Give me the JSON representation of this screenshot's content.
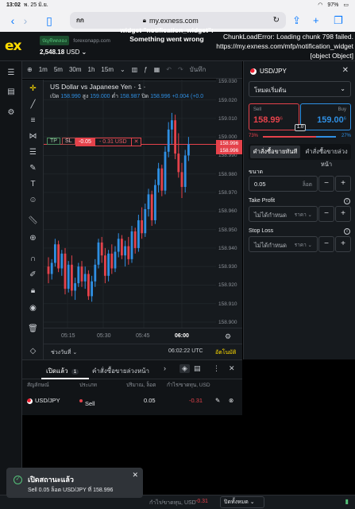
{
  "status_bar": {
    "time": "13:02",
    "date": "พ. 25 มิ.ย.",
    "battery": "97%"
  },
  "safari": {
    "reader_label": "กก",
    "url": "my.exness.com"
  },
  "header": {
    "logo": "ex",
    "account_badge": "บัญชีทดลอง",
    "account_site": "forexonapp.com",
    "balance": "2,548.18",
    "balance_currency": "USD",
    "widget_error": "widget \"notification_widget\": Something went wrong",
    "chunk_error": "ChunkLoadError: Loading chunk 798 failed. https://my.exness.com/mfp/notification_widget [object Object]"
  },
  "chart_header": {
    "timeframes": [
      "1m",
      "5m",
      "30m",
      "1h",
      "15m"
    ],
    "active_tf": "15m",
    "extra": "บันทึก"
  },
  "chart": {
    "title": "US Dollar vs Japanese Yen · 1 ·",
    "ohlc": {
      "open_label": "เปิด",
      "open": "158.990",
      "high_label": "สูง",
      "high": "159.000",
      "low_label": "ต่ำ",
      "low": "158.987",
      "close_label": "ปิด",
      "close": "158.996",
      "change": "+0.004 (+0.0"
    },
    "tp_label": "TP",
    "sl_label": "SL",
    "position_volume": "-0.05",
    "position_pl": "- 0.31 USD",
    "position_close": "✕",
    "price_ticks": [
      "159.030",
      "159.020",
      "159.010",
      "159.000",
      "158.990",
      "158.980",
      "158.970",
      "158.960",
      "158.950",
      "158.940",
      "158.930",
      "158.920",
      "158.910",
      "158.900"
    ],
    "tag_bid": "158.996",
    "tag_ask": "158.996",
    "time_ticks": [
      "05:15",
      "05:30",
      "05:45",
      "06:00"
    ],
    "range_label": "ช่วงวันที่",
    "clock": "06:02:22 UTC",
    "auto_label": "อัตโนมัติ",
    "colors": {
      "up": "#2f8fe3",
      "down": "#e5424b",
      "bg": "#161a1e"
    }
  },
  "chart_data": {
    "type": "candlestick",
    "title": "US Dollar vs Japanese Yen · 1 ·",
    "ylim": [
      158.897,
      159.031
    ],
    "x_ticks": [
      "05:15",
      "05:30",
      "05:45",
      "06:00"
    ],
    "candles": [
      [
        158.93,
        158.935,
        158.921,
        158.926
      ],
      [
        158.926,
        158.934,
        158.923,
        158.932
      ],
      [
        158.932,
        158.945,
        158.93,
        158.942
      ],
      [
        158.942,
        158.944,
        158.927,
        158.929
      ],
      [
        158.929,
        158.939,
        158.925,
        158.937
      ],
      [
        158.937,
        158.94,
        158.915,
        158.918
      ],
      [
        158.918,
        158.933,
        158.916,
        158.931
      ],
      [
        158.931,
        158.936,
        158.914,
        158.917
      ],
      [
        158.917,
        158.924,
        158.912,
        158.921
      ],
      [
        158.921,
        158.932,
        158.919,
        158.93
      ],
      [
        158.93,
        158.933,
        158.919,
        158.922
      ],
      [
        158.922,
        158.93,
        158.918,
        158.926
      ],
      [
        158.926,
        158.928,
        158.912,
        158.914
      ],
      [
        158.914,
        158.925,
        158.911,
        158.922
      ],
      [
        158.922,
        158.934,
        158.919,
        158.931
      ],
      [
        158.931,
        158.945,
        158.929,
        158.943
      ],
      [
        158.943,
        158.946,
        158.932,
        158.936
      ],
      [
        158.936,
        158.94,
        158.921,
        158.925
      ],
      [
        158.925,
        158.939,
        158.922,
        158.937
      ],
      [
        158.937,
        158.942,
        158.926,
        158.929
      ],
      [
        158.929,
        158.941,
        158.927,
        158.938
      ],
      [
        158.938,
        158.948,
        158.935,
        158.945
      ],
      [
        158.945,
        158.947,
        158.934,
        158.936
      ],
      [
        158.936,
        158.944,
        158.93,
        158.941
      ],
      [
        158.941,
        158.946,
        158.931,
        158.934
      ],
      [
        158.934,
        158.952,
        158.932,
        158.949
      ],
      [
        158.949,
        158.951,
        158.937,
        158.94
      ],
      [
        158.94,
        158.958,
        158.938,
        158.955
      ],
      [
        158.955,
        158.962,
        158.945,
        158.948
      ],
      [
        158.948,
        158.964,
        158.946,
        158.961
      ],
      [
        158.961,
        158.972,
        158.957,
        158.969
      ],
      [
        158.969,
        158.971,
        158.952,
        158.955
      ],
      [
        158.955,
        158.977,
        158.953,
        158.974
      ],
      [
        158.974,
        158.986,
        158.97,
        158.983
      ],
      [
        158.983,
        158.985,
        158.968,
        158.971
      ],
      [
        158.971,
        158.995,
        158.969,
        158.992
      ],
      [
        158.992,
        159.008,
        158.989,
        159.004
      ],
      [
        159.004,
        159.013,
        158.996,
        159.009
      ],
      [
        159.009,
        159.012,
        158.988,
        158.991
      ],
      [
        158.991,
        159.002,
        158.978,
        158.981
      ],
      [
        158.981,
        158.986,
        158.967,
        158.973
      ],
      [
        158.973,
        158.993,
        158.97,
        158.99
      ],
      [
        158.99,
        159.0,
        158.987,
        158.996
      ]
    ]
  },
  "order_panel": {
    "symbol": "USD/JPY",
    "mode": "โหมดเริ่มต้น",
    "sell_label": "Sell",
    "sell_price_main": "158.99",
    "sell_price_sup": "6",
    "buy_label": "Buy",
    "buy_price_main": "159.00",
    "buy_price_sup": "6",
    "spread": "1.0",
    "sell_pct": "73%",
    "buy_pct": "27%",
    "sell_fraction": 0.73,
    "tab_market": "คำสั่งซื้อขายทันที",
    "tab_pending": "คำสั่งซื้อขายล่วงหน้า",
    "volume_label": "ขนาด",
    "volume_value": "0.05",
    "volume_unit": "ล็อต",
    "tp_label": "Take Profit",
    "tp_placeholder": "ไม่ได้กำหนด",
    "tp_unit": "ราคา",
    "sl_label": "Stop Loss",
    "sl_placeholder": "ไม่ได้กำหนด",
    "sl_unit": "ราคา"
  },
  "positions": {
    "tab_open": "เปิดแล้ว",
    "open_count": "1",
    "tab_pending": "คำสั่งซื้อขายล่วงหน้า",
    "cols": [
      "สัญลักษณ์",
      "ประเภท",
      "ปริมาณ, ล็อต",
      "กำไร/ขาดทุน, USD"
    ],
    "rows": [
      {
        "symbol": "USD/JPY",
        "type": "Sell",
        "volume": "0.05",
        "pl": "-0.31"
      }
    ]
  },
  "bottom": {
    "pl_label": "กำไร/ขาดทุน, USD",
    "pl_value": "-0.31",
    "close_all": "ปิดทั้งหมด"
  },
  "toast": {
    "title": "เปิดสถานะแล้ว",
    "message": "Sell 0.05 ล็อต USD/JPY ที่ 158.996"
  }
}
